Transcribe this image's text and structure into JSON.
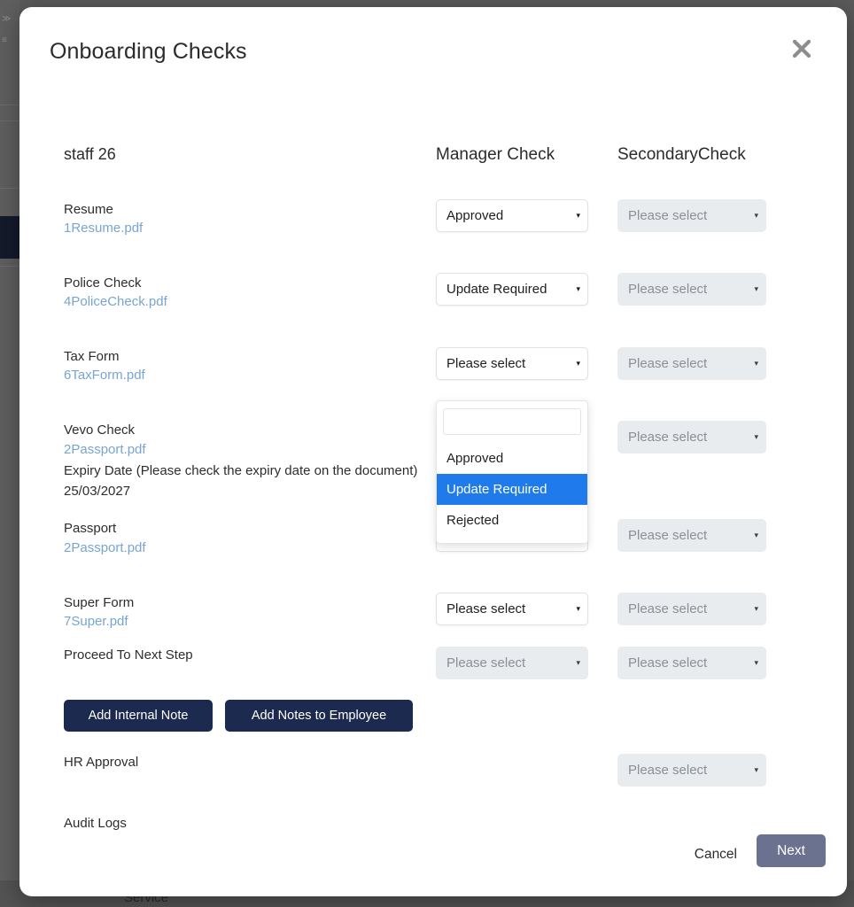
{
  "background": {
    "footer_label": "Service"
  },
  "modal": {
    "title": "Onboarding Checks",
    "close_icon": "close-icon"
  },
  "headers": {
    "staff": "staff 26",
    "manager_check": "Manager Check",
    "secondary_check": "SecondaryCheck"
  },
  "rows": [
    {
      "label": "Resume",
      "file": "1Resume.pdf",
      "manager": {
        "value": "Approved",
        "disabled": false,
        "placeholder": false
      },
      "secondary": {
        "value": "Please select",
        "disabled": true,
        "placeholder": true
      }
    },
    {
      "label": "Police Check",
      "file": "4PoliceCheck.pdf",
      "manager": {
        "value": "Update Required",
        "disabled": false,
        "placeholder": false
      },
      "secondary": {
        "value": "Please select",
        "disabled": true,
        "placeholder": true
      }
    },
    {
      "label": "Tax Form",
      "file": "6TaxForm.pdf",
      "manager": {
        "value": "Please select",
        "disabled": false,
        "placeholder": true
      },
      "secondary": {
        "value": "Please select",
        "disabled": true,
        "placeholder": true
      }
    },
    {
      "label": "Vevo Check",
      "file": "2Passport.pdf",
      "expiry_note": "Expiry Date (Please check the expiry date on the document)",
      "expiry_date": "25/03/2027",
      "manager": {
        "value": "Please select",
        "disabled": false,
        "placeholder": true
      },
      "secondary": {
        "value": "Please select",
        "disabled": true,
        "placeholder": true
      }
    },
    {
      "label": "Passport",
      "file": "2Passport.pdf",
      "manager": {
        "value": "Please select",
        "disabled": false,
        "placeholder": true
      },
      "secondary": {
        "value": "Please select",
        "disabled": true,
        "placeholder": true
      }
    },
    {
      "label": "Super Form",
      "file": "7Super.pdf",
      "manager": {
        "value": "Please select",
        "disabled": false,
        "placeholder": true
      },
      "secondary": {
        "value": "Please select",
        "disabled": true,
        "placeholder": true
      }
    },
    {
      "label": "Proceed To Next Step",
      "file": "",
      "manager": {
        "value": "Please select",
        "disabled": true,
        "placeholder": true
      },
      "secondary": {
        "value": "Please select",
        "disabled": true,
        "placeholder": true
      }
    }
  ],
  "open_dropdown": {
    "belongs_to_row": "Police Check",
    "search_value": "",
    "search_placeholder": "",
    "options": [
      "Approved",
      "Update Required",
      "Rejected"
    ],
    "selected_option": "Update Required",
    "highlight_color": "#1f7bec"
  },
  "note_buttons": {
    "internal": "Add Internal Note",
    "employee": "Add Notes to Employee",
    "color": "#1c2a4f"
  },
  "hr_approval": {
    "label": "HR Approval",
    "select": {
      "value": "Please select",
      "disabled": true,
      "placeholder": true
    }
  },
  "audit_logs": {
    "label": "Audit Logs"
  },
  "footer": {
    "cancel": "Cancel",
    "next": "Next",
    "next_color": "#6b7290"
  },
  "caret_glyph": "▾"
}
